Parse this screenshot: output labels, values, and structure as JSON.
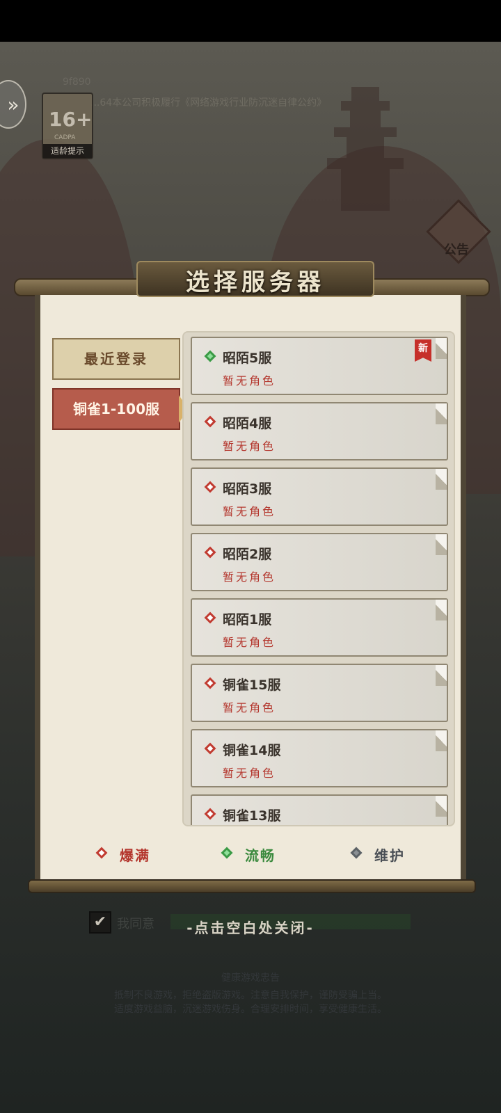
{
  "background": {
    "version_text": "9f890",
    "notice_text": "...64本公司积极履行《网络游戏行业防沉迷自律公约》",
    "age_rating": {
      "number": "16+",
      "cadpa": "CADPA",
      "label": "适龄提示"
    },
    "back_icon": "chevron-double-right-icon",
    "notice_button_label": "公告",
    "agree_label": "我同意",
    "health_title": "健康游戏忠告",
    "health_line1": "抵制不良游戏，拒绝盗版游戏。注意自我保护，谨防受骗上当。",
    "health_line2": "适度游戏益脑，沉迷游戏伤身。合理安排时间，享受健康生活。"
  },
  "dialog": {
    "title": "选择服务器",
    "tabs": [
      {
        "label": "最近登录",
        "active": false
      },
      {
        "label": "铜雀1-100服",
        "active": true
      }
    ],
    "servers": [
      {
        "name": "昭陌5服",
        "sub": "暂无角色",
        "status": "green",
        "is_new": true,
        "new_label": "新"
      },
      {
        "name": "昭陌4服",
        "sub": "暂无角色",
        "status": "red"
      },
      {
        "name": "昭陌3服",
        "sub": "暂无角色",
        "status": "red"
      },
      {
        "name": "昭陌2服",
        "sub": "暂无角色",
        "status": "red"
      },
      {
        "name": "昭陌1服",
        "sub": "暂无角色",
        "status": "red"
      },
      {
        "name": "铜雀15服",
        "sub": "暂无角色",
        "status": "red"
      },
      {
        "name": "铜雀14服",
        "sub": "暂无角色",
        "status": "red"
      },
      {
        "name": "铜雀13服",
        "sub": "",
        "status": "red"
      }
    ],
    "legend": [
      {
        "label": "爆满",
        "status": "red",
        "color": "#b4372e"
      },
      {
        "label": "流畅",
        "status": "green",
        "color": "#3b8a3e"
      },
      {
        "label": "维护",
        "status": "grey",
        "color": "#4a4f55"
      }
    ]
  },
  "close_hint": "-点击空白处关闭-"
}
